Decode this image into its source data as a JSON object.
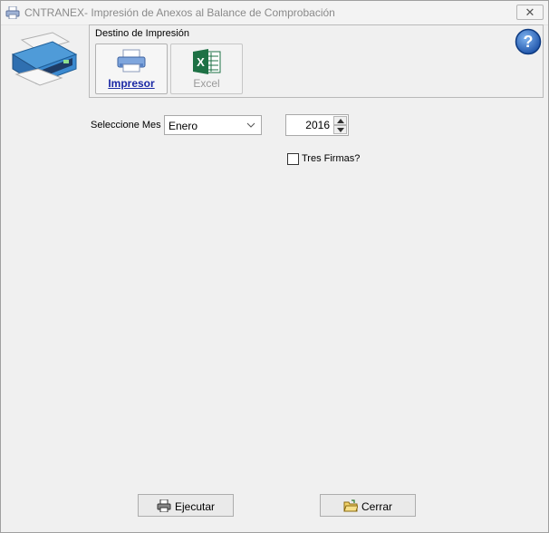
{
  "window": {
    "title": "CNTRANEX- Impresión de Anexos al Balance de Comprobación",
    "close_label": "✕"
  },
  "destino": {
    "group_label": "Destino de Impresión",
    "printer_label": "Impresor",
    "excel_label": "Excel"
  },
  "form": {
    "mes_label": "Seleccione Mes",
    "mes_value": "Enero",
    "year_value": "2016",
    "tres_firmas_label": "Tres Firmas?",
    "tres_firmas_checked": false
  },
  "buttons": {
    "ejecutar_label": "Ejecutar",
    "cerrar_label": "Cerrar"
  },
  "colors": {
    "printer_label": "#1b29a5",
    "excel_green": "#1e7145",
    "help_blue": "#1f5fbf"
  }
}
